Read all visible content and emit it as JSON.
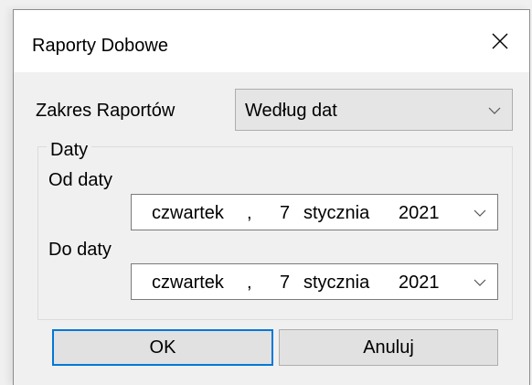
{
  "window": {
    "title": "Raporty Dobowe",
    "close_icon": "close-icon"
  },
  "range": {
    "label": "Zakres Raportów",
    "selected": "Według dat"
  },
  "dates_group": {
    "legend": "Daty",
    "from": {
      "label": "Od daty",
      "weekday": "czwartek",
      "separator": ",",
      "day": "7",
      "month": "stycznia",
      "year": "2021"
    },
    "to": {
      "label": "Do daty",
      "weekday": "czwartek",
      "separator": ",",
      "day": "7",
      "month": "stycznia",
      "year": "2021"
    }
  },
  "buttons": {
    "ok": "OK",
    "cancel": "Anuluj"
  },
  "colors": {
    "window_bg": "#f0f0f0",
    "titlebar_bg": "#ffffff",
    "accent_focus": "#0078d7",
    "button_bg": "#e1e1e1",
    "combo_bg": "#e5e5e5"
  }
}
